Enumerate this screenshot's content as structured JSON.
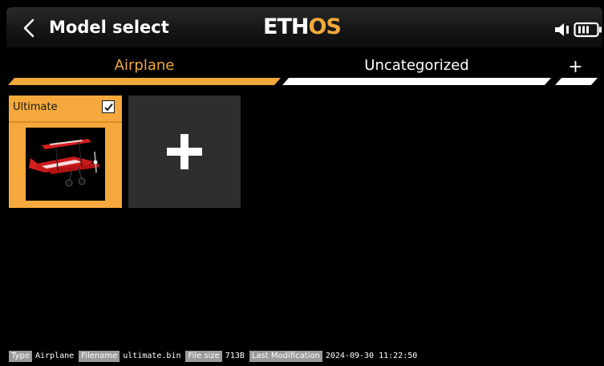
{
  "header": {
    "title": "Model select",
    "logo_left": "ETH",
    "logo_right": "OS",
    "back_icon": "chevron-left-icon",
    "speaker_icon": "speaker-icon",
    "battery_icon": "battery-icon"
  },
  "tabs": [
    {
      "label": "Airplane",
      "active": true
    },
    {
      "label": "Uncategorized",
      "active": false
    },
    {
      "label": "+",
      "active": false
    }
  ],
  "models": [
    {
      "name": "Ultimate",
      "selected": true,
      "thumbnail": "red biplane aircraft"
    }
  ],
  "add_model_icon": "plus-icon",
  "status": {
    "type_label": "Type",
    "type_value": "Airplane",
    "filename_label": "Filename",
    "filename_value": "ultimate.bin",
    "filesize_label": "File size",
    "filesize_value": "713B",
    "lastmod_label": "Last Modification",
    "lastmod_value": "2024-09-30 11:22:50"
  },
  "colors": {
    "accent": "#f2a93b",
    "card_selected": "#f5a93c",
    "card_add": "#2e2e2e",
    "background": "#000000",
    "status_label_bg": "#9b9b9b"
  }
}
